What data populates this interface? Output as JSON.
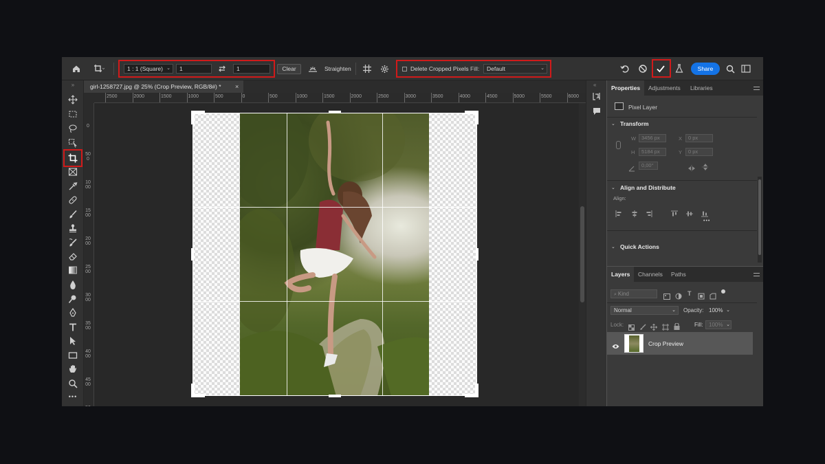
{
  "options_bar": {
    "ratio_preset": "1 : 1 (Square)",
    "width_value": "1",
    "height_value": "1",
    "clear_label": "Clear",
    "straighten_label": "Straighten",
    "delete_cropped_label": "Delete Cropped Pixels",
    "fill_label": "Fill:",
    "fill_value": "Default",
    "share_label": "Share"
  },
  "document": {
    "tab_title": "girl-1258727.jpg @ 25% (Crop Preview, RGB/8#) *",
    "close_glyph": "×"
  },
  "ruler": {
    "h_ticks": [
      "2500",
      "2000",
      "1500",
      "1000",
      "500",
      "0",
      "500",
      "1000",
      "1500",
      "2000",
      "2500",
      "3000",
      "3500",
      "4000",
      "4500",
      "5000",
      "5500",
      "6000"
    ],
    "v_ticks": [
      "0",
      "500",
      "1000",
      "1500",
      "2000",
      "2500",
      "3000",
      "3500",
      "4000",
      "4500",
      "5000"
    ]
  },
  "properties_panel": {
    "tabs": [
      "Properties",
      "Adjustments",
      "Libraries"
    ],
    "layer_type": "Pixel Layer",
    "transform_heading": "Transform",
    "w_label": "W",
    "w_value": "3456 px",
    "h_label": "H",
    "h_value": "5184 px",
    "x_label": "X",
    "x_value": "0 px",
    "y_label": "Y",
    "y_value": "0 px",
    "angle_value": "0,00°",
    "align_heading": "Align and Distribute",
    "align_label": "Align:",
    "more_glyph": "•••",
    "quick_actions_heading": "Quick Actions"
  },
  "layers_panel": {
    "tabs": [
      "Layers",
      "Channels",
      "Paths"
    ],
    "kind_placeholder": "Kind",
    "blend_mode": "Normal",
    "opacity_label": "Opacity:",
    "opacity_value": "100%",
    "lock_label": "Lock:",
    "fill_label": "Fill:",
    "fill_value": "100%",
    "layer_name": "Crop Preview"
  },
  "colors": {
    "highlight": "#d11a1a",
    "accent": "#1473e6"
  }
}
